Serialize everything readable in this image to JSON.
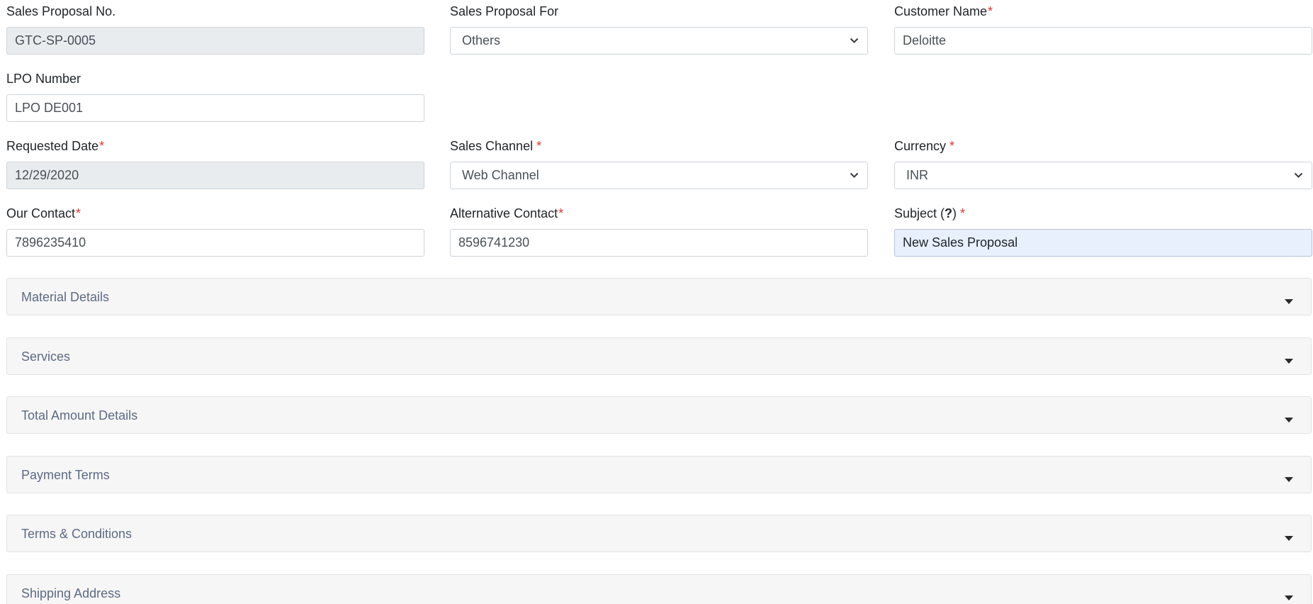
{
  "form": {
    "sales_proposal_no": {
      "label": "Sales Proposal No.",
      "value": "GTC-SP-0005"
    },
    "sales_proposal_for": {
      "label": "Sales Proposal For",
      "value": "Others"
    },
    "customer_name": {
      "label": "Customer Name",
      "required_mark": "*",
      "value": "Deloitte"
    },
    "lpo_number": {
      "label": "LPO Number",
      "value": "LPO DE001"
    },
    "requested_date": {
      "label": "Requested Date",
      "required_mark": "*",
      "value": "12/29/2020"
    },
    "sales_channel": {
      "label": "Sales Channel",
      "required_mark": "*",
      "value": "Web Channel"
    },
    "currency": {
      "label": "Currency",
      "required_mark": "*",
      "value": "INR"
    },
    "our_contact": {
      "label": "Our Contact",
      "required_mark": "*",
      "value": "7896235410"
    },
    "alternative_contact": {
      "label": "Alternative Contact",
      "required_mark": "*",
      "value": "8596741230"
    },
    "subject": {
      "label_prefix": "Subject (",
      "help_mark": "?",
      "label_suffix": ")",
      "required_mark": "*",
      "value": "New Sales Proposal"
    }
  },
  "sections": [
    {
      "title": "Material Details",
      "icon": "caret-down-icon"
    },
    {
      "title": "Services",
      "icon": "caret-down-icon"
    },
    {
      "title": "Total Amount Details",
      "icon": "caret-down-icon"
    },
    {
      "title": "Payment Terms",
      "icon": "caret-down-icon"
    },
    {
      "title": "Terms & Conditions",
      "icon": "caret-down-icon"
    },
    {
      "title": "Shipping Address",
      "icon": "caret-down-icon"
    }
  ],
  "colors": {
    "required": "#e3342f",
    "readonly_bg": "#e9ecef",
    "focused_bg": "#e8f0fe",
    "panel_bg": "#f6f6f6",
    "panel_title": "#5d6a85"
  }
}
